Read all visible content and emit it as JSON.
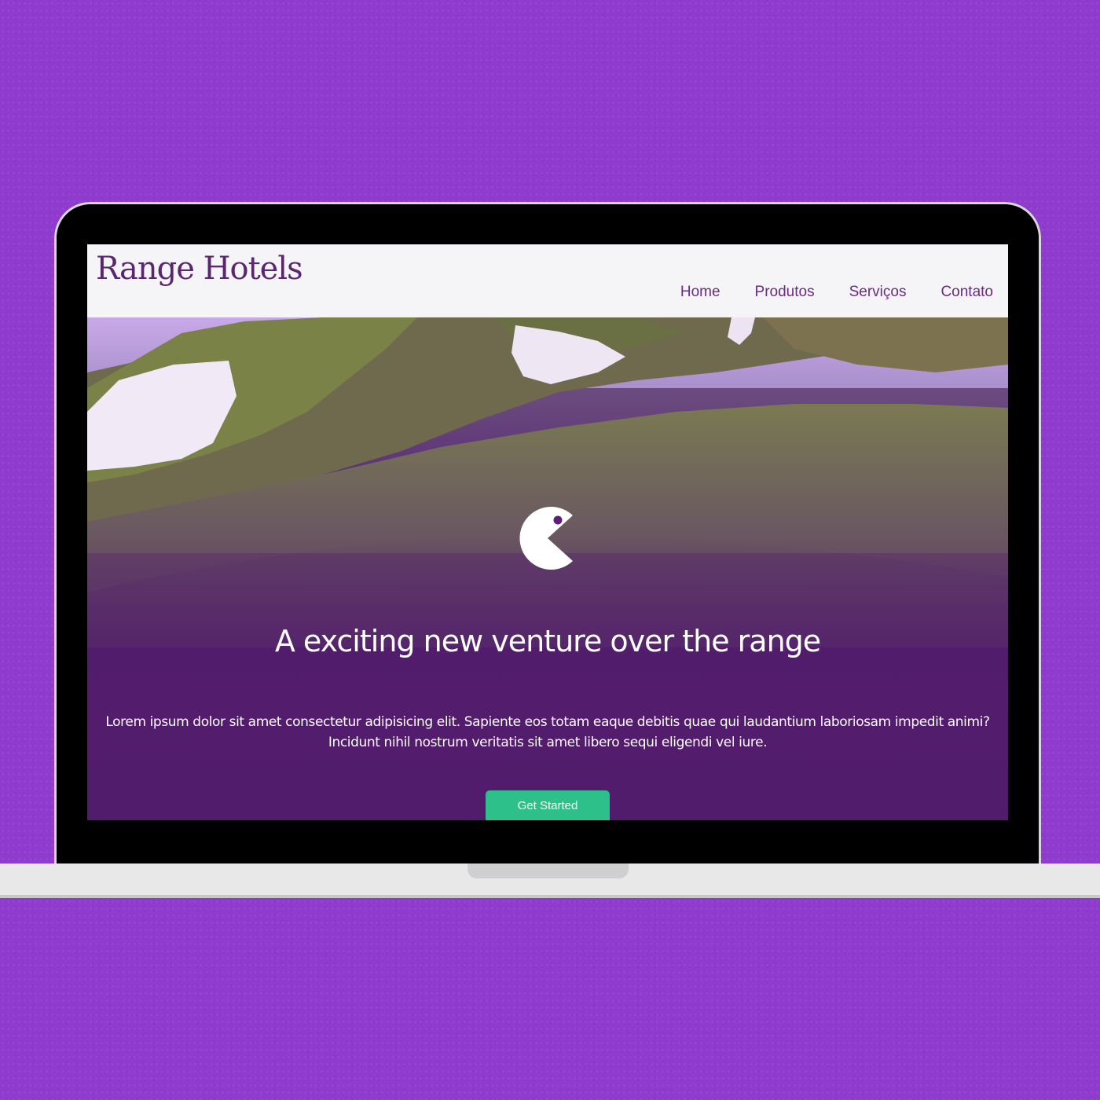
{
  "site": {
    "logo": "Range Hotels",
    "nav": [
      "Home",
      "Produtos",
      "Serviços",
      "Contato"
    ]
  },
  "hero": {
    "title": "A exciting new venture over the range",
    "text": "Lorem ipsum dolor sit amet consectetur adipisicing elit. Sapiente eos totam eaque debitis quae qui laudantium laboriosam impedit animi? Incidunt nihil nostrum veritatis sit amet libero sequi eligendi vel iure.",
    "cta_label": "Get Started",
    "icon": "pacman-icon"
  },
  "colors": {
    "background": "#8e3bce",
    "header": "#f5f4f6",
    "brand": "#5b2670",
    "hero_overlay": "#521d6d",
    "cta": "#2ec08a"
  }
}
